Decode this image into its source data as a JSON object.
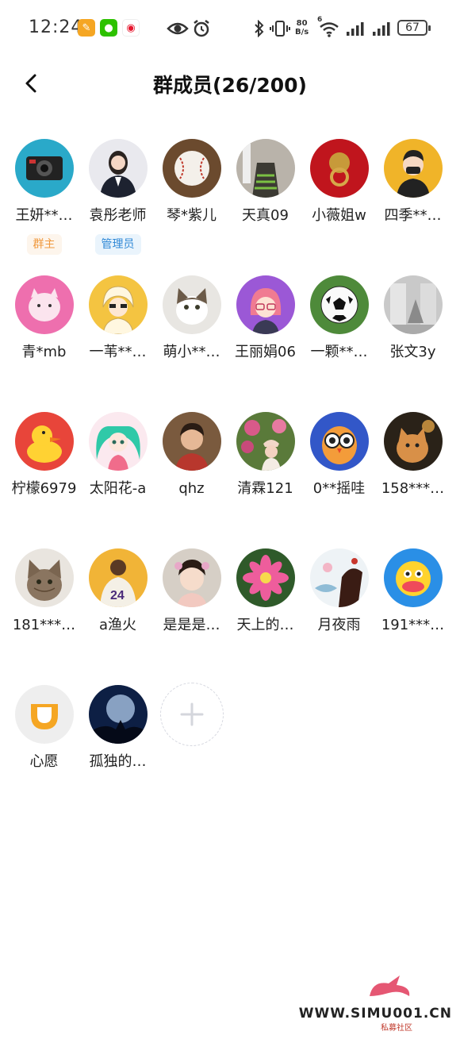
{
  "status_bar": {
    "time": "12:24",
    "speed_top": "80",
    "speed_bottom": "B/s",
    "wifi_index": "6",
    "battery": "67"
  },
  "header": {
    "title": "群成员(26/200)"
  },
  "members": [
    {
      "name": "王妍**…",
      "badge": "群主"
    },
    {
      "name": "袁彤老师",
      "badge": "管理员"
    },
    {
      "name": "琴*紫儿"
    },
    {
      "name": "天真09"
    },
    {
      "name": "小薇姐w"
    },
    {
      "name": "四季**…"
    },
    {
      "name": "青*mb"
    },
    {
      "name": "一苇**…"
    },
    {
      "name": "萌小**…"
    },
    {
      "name": "王丽娟06"
    },
    {
      "name": "一颗**…"
    },
    {
      "name": "张文3y"
    },
    {
      "name": "柠檬6979"
    },
    {
      "name": "太阳花-a"
    },
    {
      "name": "qhz"
    },
    {
      "name": "清霖121"
    },
    {
      "name": "0**摇哇"
    },
    {
      "name": "158***…"
    },
    {
      "name": "181***…"
    },
    {
      "name": "a渔火"
    },
    {
      "name": "是是是…"
    },
    {
      "name": "天上的…"
    },
    {
      "name": "月夜雨"
    },
    {
      "name": "191***…"
    },
    {
      "name": "心愿"
    },
    {
      "name": "孤独的…"
    }
  ],
  "watermark": {
    "text": "WWW.SIMU001.CN",
    "sub": "私募社区"
  },
  "colors": {
    "owner_badge": "#f0993e",
    "admin_badge": "#2f88d6"
  }
}
